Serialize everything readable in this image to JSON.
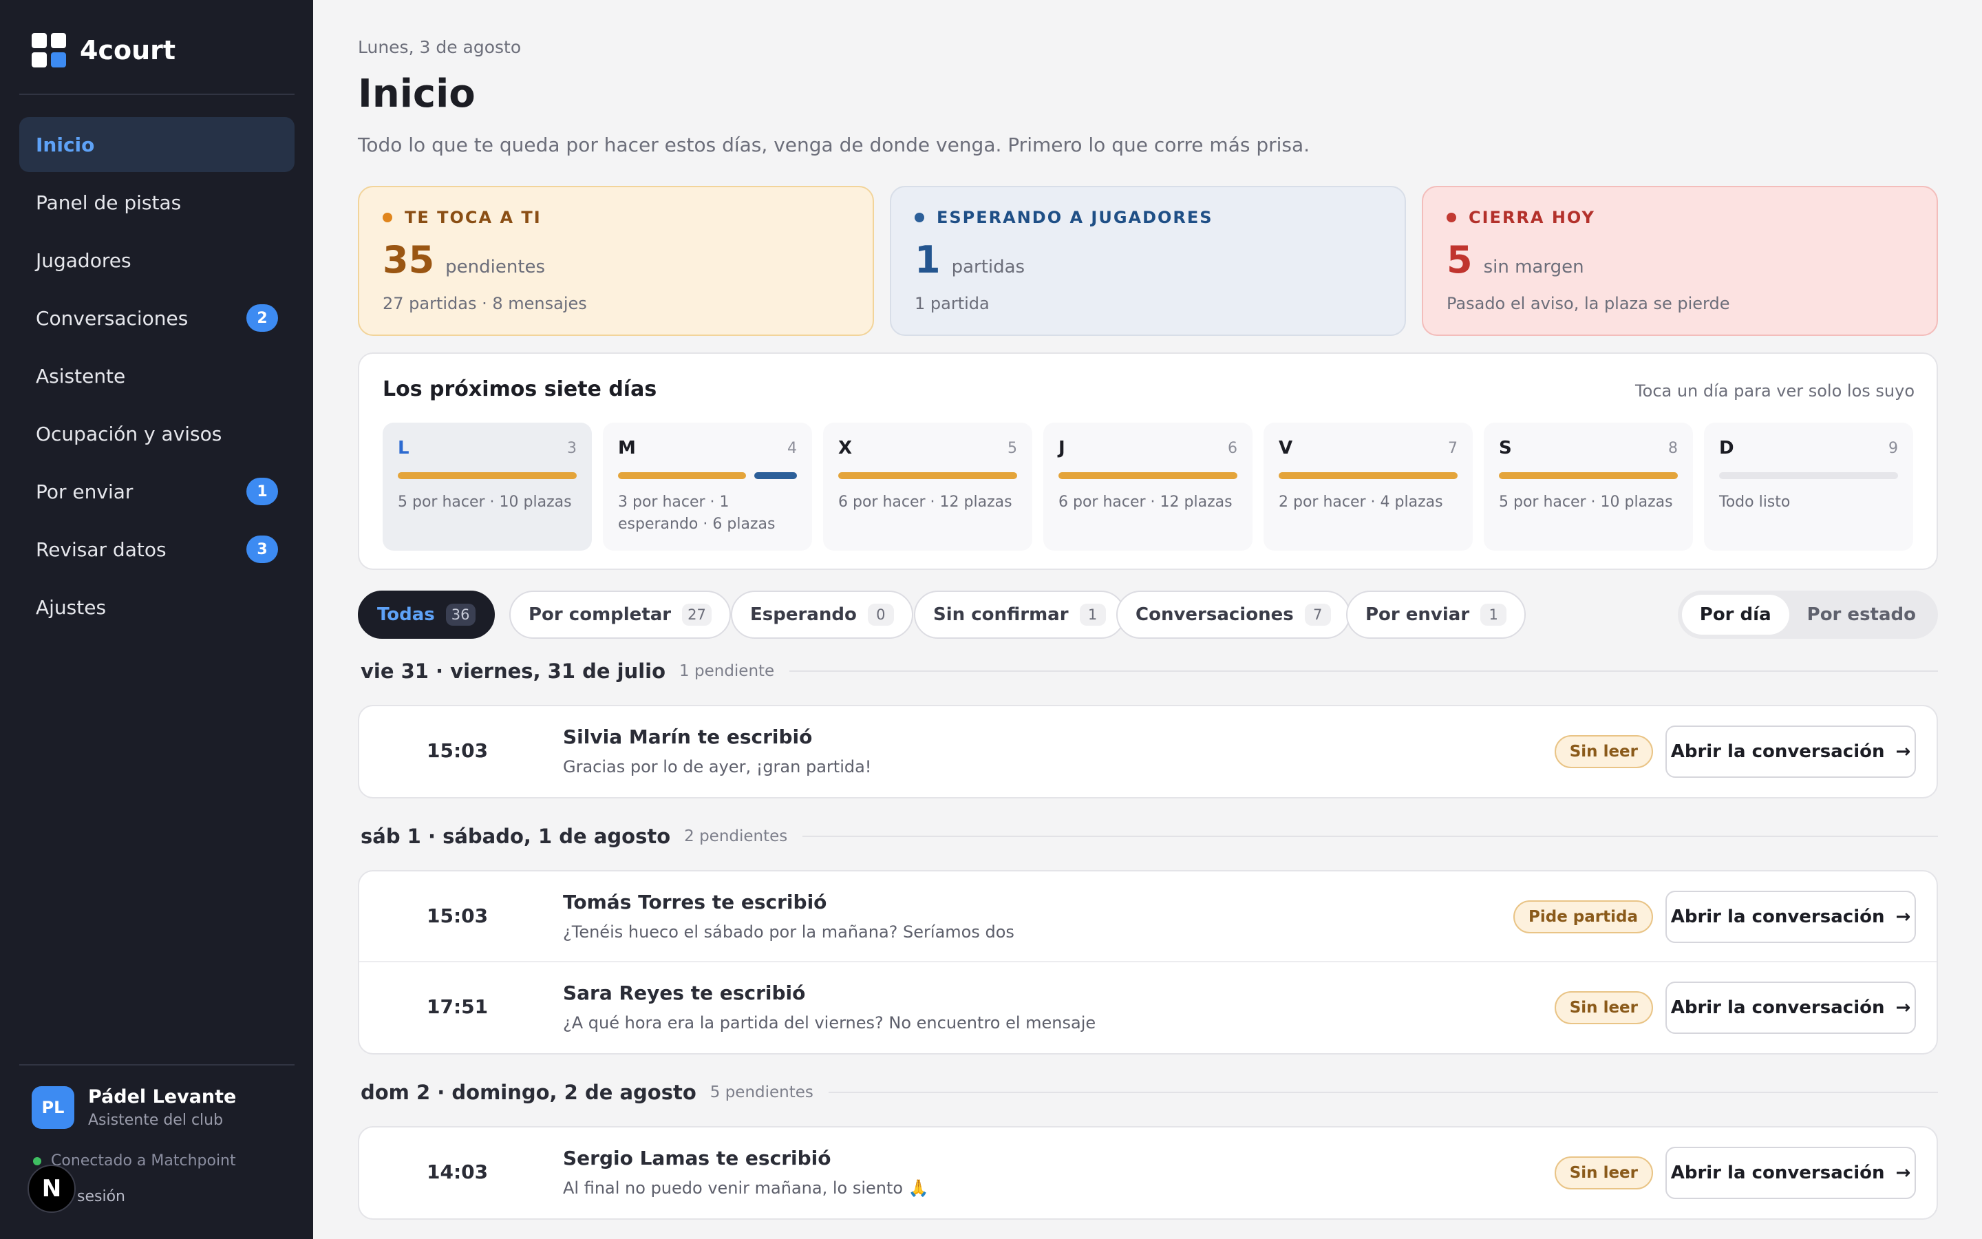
{
  "app": {
    "name": "4court"
  },
  "sidebar": {
    "items": [
      {
        "label": "Inicio",
        "badge": ""
      },
      {
        "label": "Panel de pistas",
        "badge": ""
      },
      {
        "label": "Jugadores",
        "badge": ""
      },
      {
        "label": "Conversaciones",
        "badge": "2"
      },
      {
        "label": "Asistente",
        "badge": ""
      },
      {
        "label": "Ocupación y avisos",
        "badge": ""
      },
      {
        "label": "Por enviar",
        "badge": "1"
      },
      {
        "label": "Revisar datos",
        "badge": "3"
      },
      {
        "label": "Ajustes",
        "badge": ""
      }
    ],
    "profile": {
      "initials": "PL",
      "name": "Pádel Levante",
      "role": "Asistente del club"
    },
    "connection": "Conectado a Matchpoint",
    "logout": "sesión",
    "n_badge": "N"
  },
  "header": {
    "date": "Lunes, 3 de agosto",
    "title": "Inicio",
    "subtitle": "Todo lo que te queda por hacer estos días, venga de donde venga. Primero lo que corre más prisa."
  },
  "stats": [
    {
      "label": "TE TOCA A TI",
      "value": "35",
      "unit": "pendientes",
      "sub": "27 partidas · 8 mensajes"
    },
    {
      "label": "ESPERANDO A JUGADORES",
      "value": "1",
      "unit": "partidas",
      "sub": "1 partida"
    },
    {
      "label": "CIERRA HOY",
      "value": "5",
      "unit": "sin margen",
      "sub": "Pasado el aviso, la plaza se pierde"
    }
  ],
  "week": {
    "title": "Los próximos siete días",
    "hint": "Toca un día para ver solo los suyo",
    "colors": {
      "todo": "#e4a43a",
      "waiting": "#2c5f99",
      "empty": "#e6e6ea"
    },
    "days": [
      {
        "letter": "L",
        "num": "3",
        "text": "5 por hacer · 10 plazas",
        "todo": 1,
        "waiting": 0
      },
      {
        "letter": "M",
        "num": "4",
        "text": "3 por hacer · 1 esperando · 6 plazas",
        "todo": 0.75,
        "waiting": 0.25
      },
      {
        "letter": "X",
        "num": "5",
        "text": "6 por hacer · 12 plazas",
        "todo": 1,
        "waiting": 0
      },
      {
        "letter": "J",
        "num": "6",
        "text": "6 por hacer · 12 plazas",
        "todo": 1,
        "waiting": 0
      },
      {
        "letter": "V",
        "num": "7",
        "text": "2 por hacer · 4 plazas",
        "todo": 1,
        "waiting": 0
      },
      {
        "letter": "S",
        "num": "8",
        "text": "5 por hacer · 10 plazas",
        "todo": 1,
        "waiting": 0
      },
      {
        "letter": "D",
        "num": "9",
        "text": "Todo listo",
        "todo": 0,
        "waiting": 0
      }
    ]
  },
  "filters": [
    {
      "label": "Todas",
      "count": "36"
    },
    {
      "label": "Por completar",
      "count": "27"
    },
    {
      "label": "Esperando",
      "count": "0"
    },
    {
      "label": "Sin confirmar",
      "count": "1"
    },
    {
      "label": "Conversaciones",
      "count": "7"
    },
    {
      "label": "Por enviar",
      "count": "1"
    }
  ],
  "view_toggle": {
    "by_day": "Por día",
    "by_state": "Por estado"
  },
  "open_label": "Abrir la conversación",
  "groups": [
    {
      "title": "vie 31 · viernes, 31 de julio",
      "count": "1 pendiente",
      "rows": [
        {
          "time": "15:03",
          "title": "Silvia Marín te escribió",
          "text": "Gracias por lo de ayer, ¡gran partida!",
          "tag": "Sin leer"
        }
      ]
    },
    {
      "title": "sáb 1 · sábado, 1 de agosto",
      "count": "2 pendientes",
      "rows": [
        {
          "time": "15:03",
          "title": "Tomás Torres te escribió",
          "text": "¿Tenéis hueco el sábado por la mañana? Seríamos dos",
          "tag": "Pide partida"
        },
        {
          "time": "17:51",
          "title": "Sara Reyes te escribió",
          "text": "¿A qué hora era la partida del viernes? No encuentro el mensaje",
          "tag": "Sin leer"
        }
      ]
    },
    {
      "title": "dom 2 · domingo, 2 de agosto",
      "count": "5 pendientes",
      "rows": [
        {
          "time": "14:03",
          "title": "Sergio Lamas te escribió",
          "text": "Al final no puedo venir mañana, lo siento 🙏",
          "tag": "Sin leer"
        }
      ]
    }
  ]
}
